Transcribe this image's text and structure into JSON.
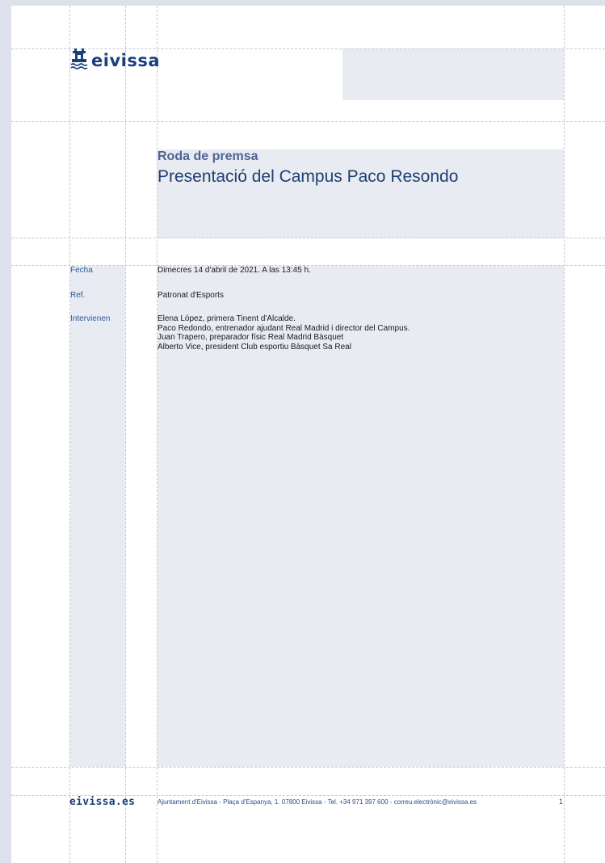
{
  "header": {
    "logo_text": "eivissa"
  },
  "headline": {
    "kicker": "Roda de premsa",
    "title": "Presentació del Campus Paco Resondo"
  },
  "details": [
    {
      "label": "Fecha",
      "lines": [
        "Dimecres 14 d'abril de 2021. A las 13:45 h."
      ]
    },
    {
      "label": "Ref.",
      "lines": [
        "Patronat d'Esports"
      ]
    },
    {
      "label": "Intervienen",
      "lines": [
        "Elena López, primera Tinent d'Alcalde.",
        "Paco Redondo, entrenador ajudant Real Madrid i director del Campus.",
        "Juan Trapero, preparador físic Real Madrid Bàsquet",
        "Alberto Vice, president Club esportiu Bàsquet Sa Real"
      ]
    }
  ],
  "footer": {
    "site": "eivissa.es",
    "address": "Ajuntament d'Eivissa - Plaça d'Espanya, 1. 07800 Eivissa - Tel. +34 971 397 600 - correu.electrònic@eivissa.es",
    "page_number": "1"
  },
  "icons": {
    "logo_symbol": "castle-waves-icon"
  },
  "colors": {
    "brand": "#1b3f7a",
    "label": "#2e5a9a",
    "panel": "#e8ebf1"
  }
}
